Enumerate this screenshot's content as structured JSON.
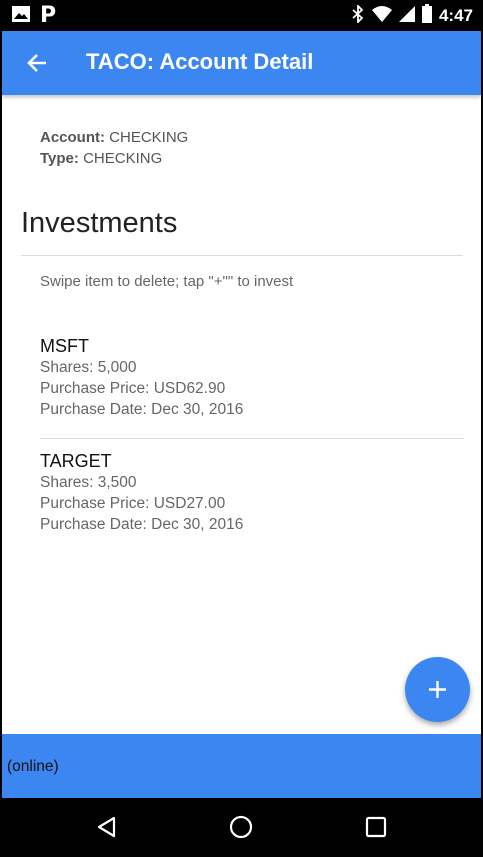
{
  "status_bar": {
    "time": "4:47",
    "left_icons": [
      "image-icon",
      "pandora-icon"
    ],
    "right_icons": [
      "bluetooth-icon",
      "wifi-icon",
      "signal-icon",
      "battery-icon"
    ]
  },
  "app_bar": {
    "title": "TACO: Account Detail",
    "back_icon": "arrow-left-icon"
  },
  "account": {
    "account_label": "Account:",
    "account_value": "CHECKING",
    "type_label": "Type:",
    "type_value": "CHECKING"
  },
  "investments": {
    "title": "Investments",
    "hint": "Swipe item to delete; tap \"+\"\" to invest",
    "items": [
      {
        "symbol": "MSFT",
        "shares": "Shares: 5,000",
        "price": "Purchase Price: USD62.90",
        "date": "Purchase Date: Dec 30, 2016"
      },
      {
        "symbol": "TARGET",
        "shares": "Shares: 3,500",
        "price": "Purchase Price: USD27.00",
        "date": "Purchase Date: Dec 30, 2016"
      }
    ]
  },
  "fab": {
    "icon": "plus-icon"
  },
  "footer": {
    "status": "(online)"
  },
  "colors": {
    "primary": "#3b86f1",
    "text_dark": "#111111",
    "text_muted": "#666666",
    "divider": "#dddddd"
  }
}
